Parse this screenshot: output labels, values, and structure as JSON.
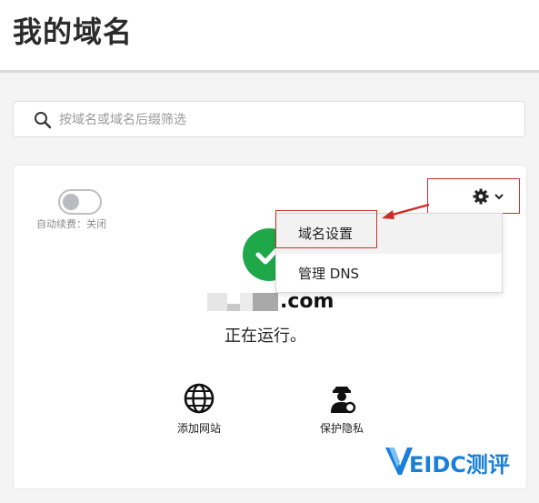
{
  "header": {
    "title": "我的域名"
  },
  "search": {
    "placeholder": "按域名或域名后缀筛选",
    "value": ""
  },
  "domain_card": {
    "auto_renew_label": "自动续费：关闭",
    "auto_renew_on": false,
    "domain_suffix": ".com",
    "status": "正在运行。",
    "actions": [
      {
        "label": "添加网站",
        "icon": "globe-icon"
      },
      {
        "label": "保护隐私",
        "icon": "privacy-user-icon"
      }
    ],
    "menu_button_icon": "gear-icon",
    "menu": [
      {
        "label": "域名设置"
      },
      {
        "label": "管理 DNS"
      }
    ]
  },
  "watermark": {
    "logo_text": "EIDC测评"
  },
  "colors": {
    "status_green": "#1fa84a",
    "annotation_red": "#c9302c",
    "watermark_blue": "#1a7fd6"
  }
}
